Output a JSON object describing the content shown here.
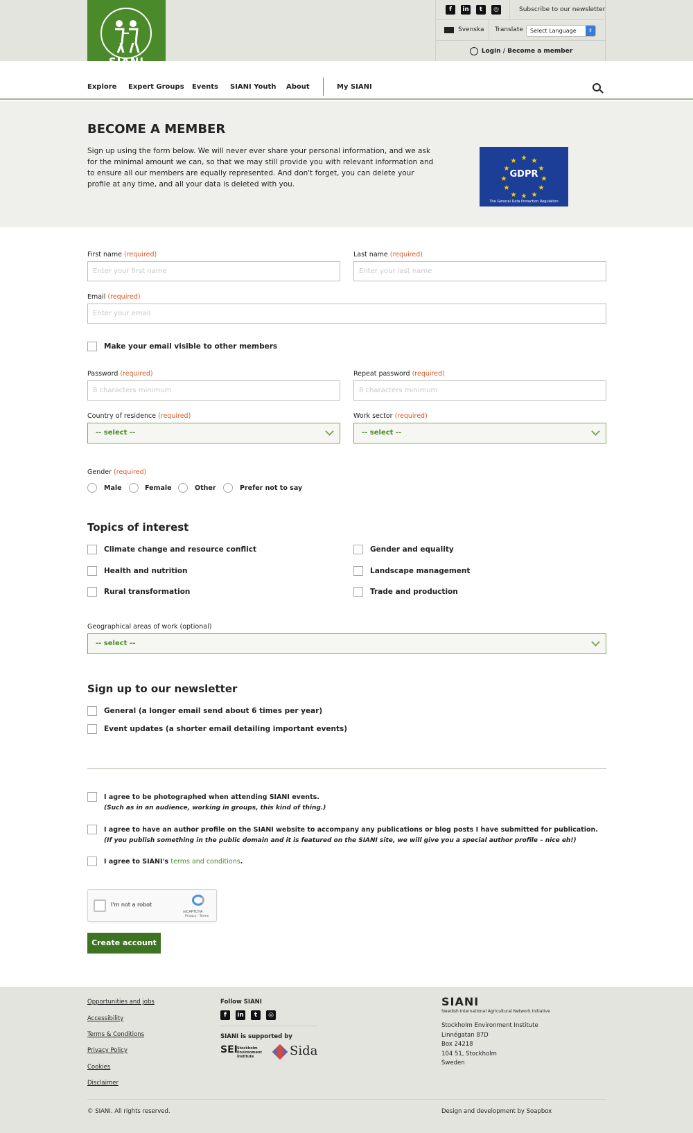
{
  "brand": {
    "logo_text": "SIANI"
  },
  "utility": {
    "social": [
      "facebook-icon",
      "linkedin-icon",
      "twitter-icon",
      "instagram-icon"
    ],
    "newsletter_link": "Subscribe to our newsletter",
    "language": "Svenska",
    "translate_label": "Translate",
    "translate_select": "Select Language",
    "login": "Login / Become a member"
  },
  "nav": {
    "items": [
      "Explore",
      "Expert Groups",
      "Events",
      "SIANI Youth",
      "About",
      "My SIANI"
    ]
  },
  "intro": {
    "title": "BECOME A MEMBER",
    "text": "Sign up using the form below.  We will never ever share your personal information, and we ask for the minimal amount we can, so that we may still provide you with relevant information and to ensure all our members are equally represented.  And don't forget, you can delete your profile at any time, and all your data is deleted with you.",
    "gdpr_title": "GDPR",
    "gdpr_caption": "The General Data Protection Regulation"
  },
  "form": {
    "required_tag": "(required)",
    "first_name": {
      "label": "First name",
      "placeholder": "Enter your first name"
    },
    "last_name": {
      "label": "Last name",
      "placeholder": "Enter your last name"
    },
    "email": {
      "label": "Email",
      "placeholder": "Enter your email"
    },
    "email_visible": "Make your email visible to other members",
    "password": {
      "label": "Password",
      "placeholder": "8 characters minimum"
    },
    "repeat_password": {
      "label": "Repeat password",
      "placeholder": "8 characters minimum"
    },
    "country": {
      "label": "Country of residence",
      "value": "-- select --"
    },
    "work_sector": {
      "label": "Work sector",
      "value": "-- select --"
    },
    "gender": {
      "label": "Gender",
      "options": [
        "Male",
        "Female",
        "Other",
        "Prefer not to say"
      ]
    },
    "topics_title": "Topics of interest",
    "topics": [
      "Climate change and resource conflict",
      "Gender and equality",
      "Health and nutrition",
      "Landscape management",
      "Rural transformation",
      "Trade and production"
    ],
    "geo": {
      "label": "Geographical areas of work (optional)",
      "value": "-- select --"
    },
    "newsletter_title": "Sign up to our newsletter",
    "newsletters": [
      "General (a longer email send about 6 times per year)",
      "Event updates (a shorter email detailing important events)"
    ],
    "consent_photo": "I agree to be photographed when attending SIANI events.",
    "consent_photo_note": "(Such as in an audience, working in groups, this kind of thing.)",
    "consent_author": "I agree to have an author profile on the SIANI website to accompany any publications or blog posts I have submitted for publication.",
    "consent_author_note": "(If you publish something in the public domain and it is featured on the SIANI site, we will give you a special author profile – nice eh!)",
    "consent_terms_prefix": "I agree to SIANI's ",
    "consent_terms_link": "terms and conditions",
    "consent_terms_suffix": ".",
    "captcha_label": "I'm not a robot",
    "captcha_brand": "reCAPTCHA",
    "captcha_links": "Privacy - Terms",
    "submit": "Create account"
  },
  "footer": {
    "links": [
      "Opportunities and jobs",
      "Accessibility",
      "Terms & Conditions",
      "Privacy Policy",
      "Cookies",
      "Disclaimer"
    ],
    "follow": "Follow SIANI",
    "supported": "SIANI is supported by",
    "sei": "SEI",
    "sei_sub": "Stockholm Environment Institute",
    "sida": "Sida",
    "org_title": "SIANI",
    "org_sub": "Swedish International Agricultural Network Initiative",
    "address": [
      "Stockholm Environment Institute",
      "Linnégatan 87D",
      "Box 24218",
      "104 51, Stockholm",
      "Sweden"
    ],
    "copyright": "© SIANI. All rights reserved.",
    "credit": "Design and development by Soapbox"
  },
  "colors": {
    "accent": "#4a8a2a",
    "required": "#d8592a",
    "bg_band": "#e4e4df",
    "gdpr": "#1c3e97"
  }
}
